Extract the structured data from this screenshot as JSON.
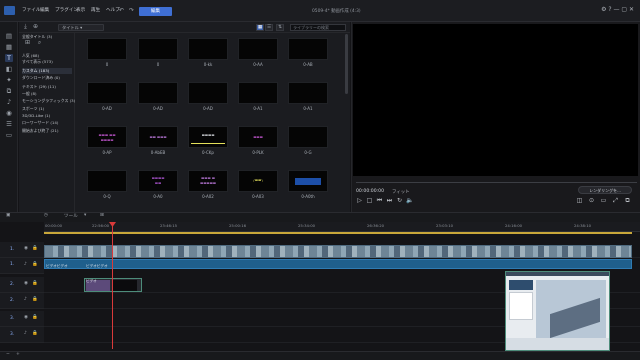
{
  "menubar": {
    "items": [
      "ファイル",
      "編集",
      "プラグイン",
      "表示",
      "再生",
      "ヘルプ"
    ],
    "mode_button": "編集",
    "project_title": "0509-4* 動画作成 (4:3)"
  },
  "library": {
    "dropdown_label": "タイトル",
    "search_placeholder": "ライブラリーの検索",
    "tree": [
      "全般タイトル (3)",
      "人気 (68)",
      "すべて表示 (573)",
      "カスタム (183)",
      "ダウンロード済み (0)",
      "テキスト (29) (11)",
      "一般 (8)",
      "モーショングラフィックス (3)",
      "スポーツ (1)",
      "3D/3D-Like (1)",
      "ローワーサード (14)",
      "開始および終了 (21)"
    ],
    "tiles": [
      [
        "0",
        "0",
        "0-kk",
        "0-AA",
        "0-AB"
      ],
      [
        "0-AD",
        "0-AD",
        "0-AD",
        "0-A1",
        "0-A1"
      ],
      [
        "0-AP",
        "0-AbEB",
        "0-CKp",
        "0-PLK",
        "0-G"
      ],
      [
        "0-Q",
        "0-A0",
        "0-A02",
        "0-A03",
        "0-A0th"
      ]
    ]
  },
  "preview": {
    "timecode": "00:00:00:00",
    "fit": "フィット",
    "quality_button": "レンダリングを..."
  },
  "timeline": {
    "tools": [
      "ツール"
    ],
    "ruler": [
      "00:00:00",
      "22:56:00",
      "23:46:15",
      "25:00:16",
      "25:34:00",
      "26:36:20",
      "23:03:10",
      "24:16:00",
      "24:38:10"
    ],
    "tracks": [
      "1.",
      "1.",
      "2.",
      "2.",
      "3.",
      "3.",
      "4."
    ],
    "clip_labels": {
      "audio1": "ビデオビデオ",
      "audio2": "ビデオビデオ",
      "small": "ビデオ"
    }
  },
  "colors": {
    "accent": "#3f6fd4",
    "playhead": "#d93a3a",
    "audio": "#1f5f8c"
  }
}
